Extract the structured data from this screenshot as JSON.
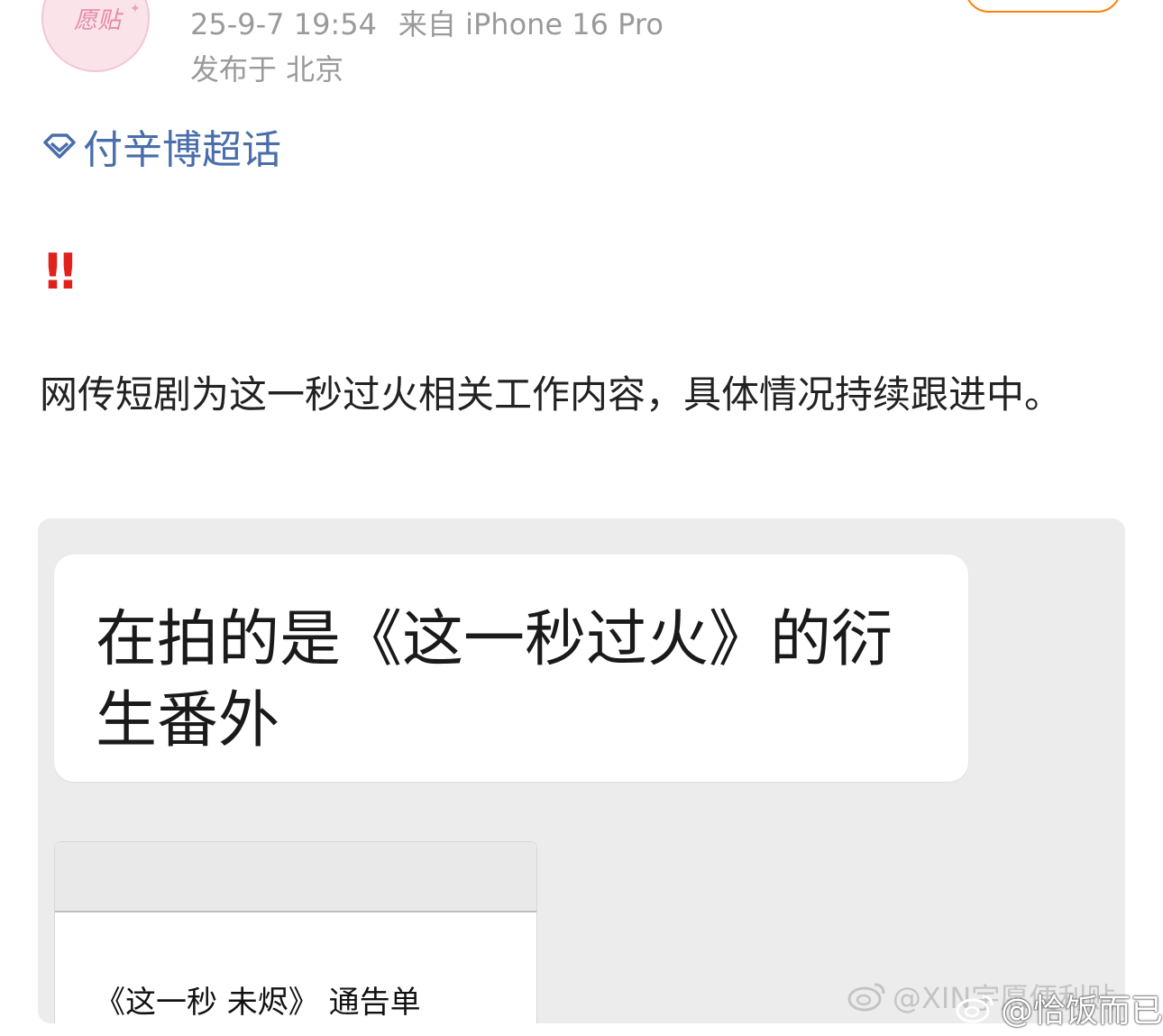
{
  "post": {
    "avatar_text": "愿贴",
    "timestamp": "25-9-7 19:54",
    "source": "来自 iPhone 16 Pro",
    "location": "发布于 北京",
    "topic": "付辛博超话",
    "alert": "‼",
    "body": "网传短剧为这一秒过火相关工作内容，具体情况持续跟进中。"
  },
  "image": {
    "bubble_text": "在拍的是《这一秒过火》的衍生番外",
    "doc_title": "《这一秒 未烬》 通告单"
  },
  "watermarks": {
    "source": "@XIN宇愿便利贴",
    "user": "@恰饭而已"
  },
  "colors": {
    "topic": "#4a6ea9",
    "alert": "#e0221b",
    "follow_border": "#ff8200"
  },
  "icons": {
    "topic": "diamond-icon",
    "watermark": "weibo-logo-icon"
  }
}
